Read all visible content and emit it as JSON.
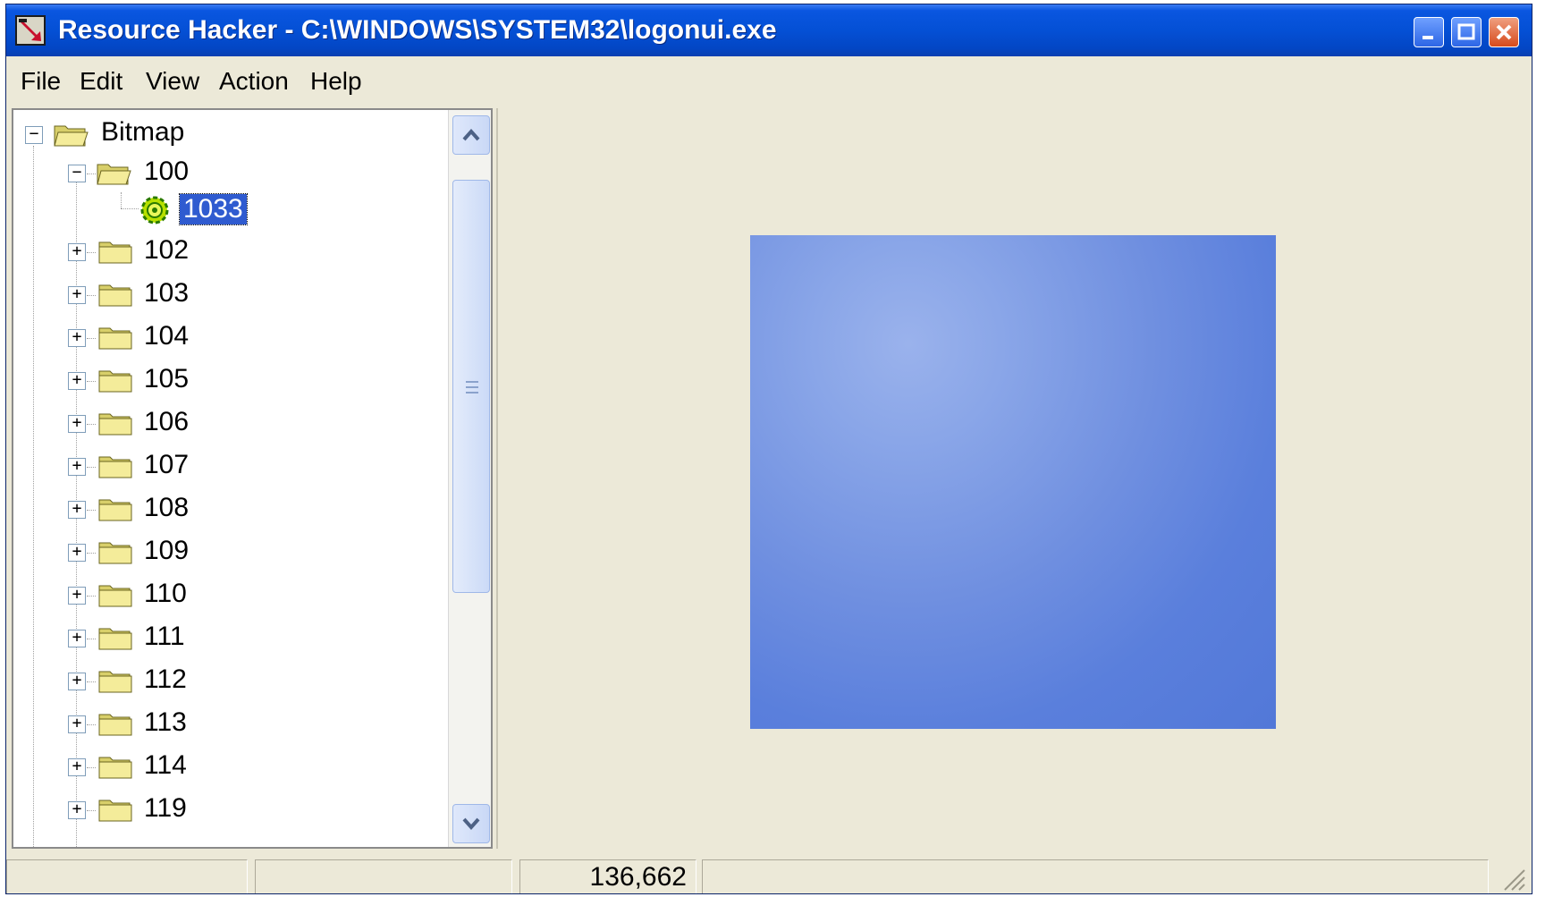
{
  "window": {
    "title": "Resource Hacker  -  C:\\WINDOWS\\SYSTEM32\\logonui.exe",
    "accent_color": "#0450d5"
  },
  "title_buttons": [
    "minimize-icon",
    "maximize-icon",
    "close-icon"
  ],
  "menu": [
    "File",
    "Edit",
    "View",
    "Action",
    "Help"
  ],
  "tree": {
    "root": "Bitmap",
    "expanded": "100",
    "selected_leaf": "1033",
    "collapsed": [
      "102",
      "103",
      "104",
      "105",
      "106",
      "107",
      "108",
      "109",
      "110",
      "111",
      "112",
      "113",
      "114",
      "119"
    ]
  },
  "preview": {
    "bitmap_color": "#5a7fdc"
  },
  "statusbar": {
    "size": "136,662"
  }
}
